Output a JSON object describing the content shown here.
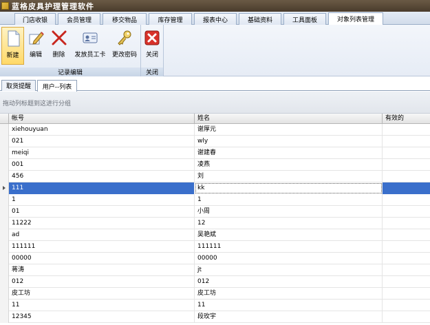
{
  "window": {
    "title": "蓝格皮具护理管理软件"
  },
  "tabs": [
    "门店收银",
    "会员管理",
    "移交物品",
    "库存管理",
    "报表中心",
    "基础资料",
    "工具面板",
    "对象列表管理"
  ],
  "active_tab": 7,
  "ribbon": {
    "groups": [
      {
        "label": "记录编辑",
        "buttons": [
          "新建",
          "编辑",
          "删除",
          "发放员工卡",
          "更改密码"
        ]
      },
      {
        "label": "关闭",
        "buttons": [
          "关闭"
        ]
      }
    ]
  },
  "doc_tabs": [
    "取货提醒",
    "用户--列表"
  ],
  "active_doc_tab": 1,
  "group_panel_hint": "拖动列标题到这进行分组",
  "grid": {
    "columns": [
      "帐号",
      "姓名",
      "有效的"
    ],
    "rows": [
      [
        "xiehouyuan",
        "谢厚元",
        ""
      ],
      [
        "021",
        "wly",
        ""
      ],
      [
        "meiqi",
        "谢建春",
        ""
      ],
      [
        "001",
        "凌燕",
        ""
      ],
      [
        "456",
        "刘",
        ""
      ],
      [
        "111",
        "kk",
        ""
      ],
      [
        "1",
        "1",
        ""
      ],
      [
        "01",
        "小周",
        ""
      ],
      [
        "11222",
        "12",
        ""
      ],
      [
        "ad",
        "吴艳斌",
        ""
      ],
      [
        "111111",
        "111111",
        ""
      ],
      [
        "00000",
        "00000",
        ""
      ],
      [
        "蒋涛",
        "jt",
        ""
      ],
      [
        "012",
        "012",
        ""
      ],
      [
        "皮工坊",
        "皮工坊",
        ""
      ],
      [
        "11",
        "11",
        ""
      ],
      [
        "12345",
        "段玫宇",
        ""
      ]
    ],
    "selected_row": 5
  },
  "colors": {
    "accent": "#3a6fcb",
    "title_bar": "#5a4a38",
    "close_red": "#d8322a"
  }
}
